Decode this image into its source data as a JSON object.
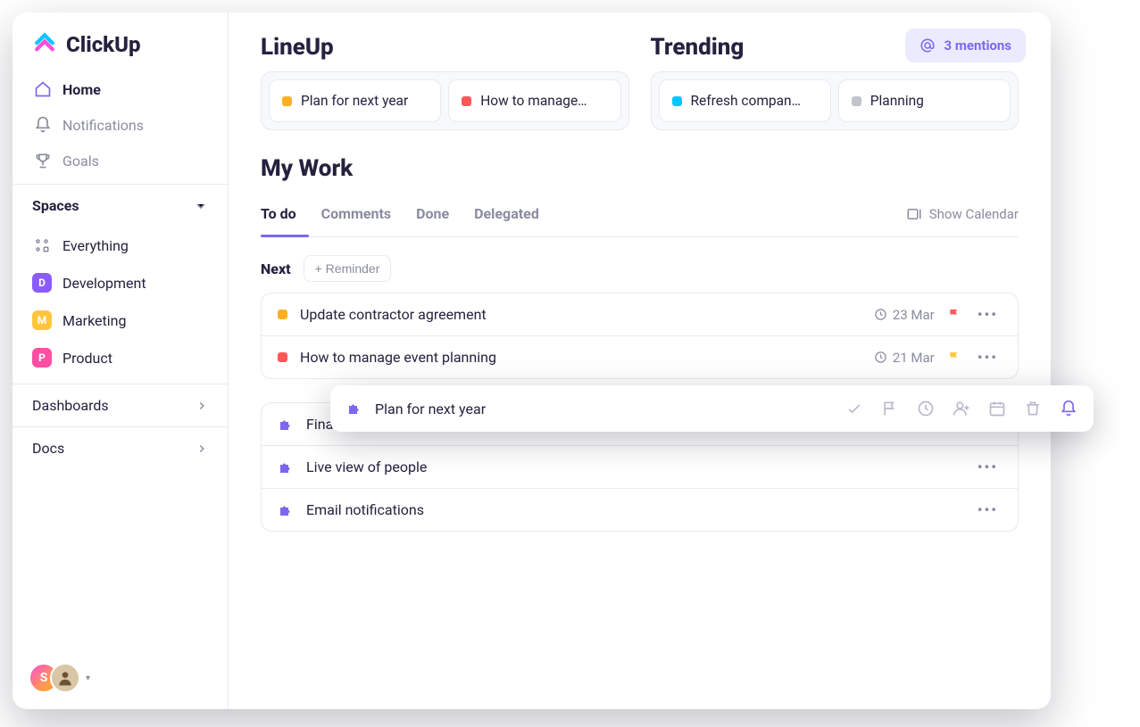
{
  "brand": {
    "name": "ClickUp"
  },
  "colors": {
    "accent": "#7b68ee",
    "orange": "#ffb020",
    "red": "#ff5757",
    "cyan": "#00c8ff",
    "grey": "#c1c3cc",
    "yellow": "#ffc63d",
    "purple": "#7b68ee",
    "pink": "#ff4fa3",
    "violet": "#8a5cff"
  },
  "nav": {
    "home": "Home",
    "notifications": "Notifications",
    "goals": "Goals"
  },
  "spaces": {
    "header": "Spaces",
    "everything": "Everything",
    "items": [
      {
        "letter": "D",
        "label": "Development",
        "color": "#8a5cff"
      },
      {
        "letter": "M",
        "label": "Marketing",
        "color": "#ffc63d"
      },
      {
        "letter": "P",
        "label": "Product",
        "color": "#ff4fa3"
      }
    ]
  },
  "footer": {
    "dashboards": "Dashboards",
    "docs": "Docs"
  },
  "avatars": {
    "initial": "S"
  },
  "mentions": {
    "label": "3 mentions"
  },
  "lineup": {
    "title": "LineUp",
    "cards": [
      {
        "text": "Plan for next year",
        "dot": "#ffb020"
      },
      {
        "text": "How to manage…",
        "dot": "#ff5757"
      }
    ]
  },
  "trending": {
    "title": "Trending",
    "cards": [
      {
        "text": "Refresh compan…",
        "dot": "#00c8ff"
      },
      {
        "text": "Planning",
        "dot": "#c1c3cc"
      }
    ]
  },
  "mywork": {
    "title": "My Work",
    "tabs": {
      "todo": "To do",
      "comments": "Comments",
      "done": "Done",
      "delegated": "Delegated"
    },
    "show_calendar": "Show Calendar",
    "next": "Next",
    "reminder": "+ Reminder",
    "tasks_upper": [
      {
        "name": "Update contractor agreement",
        "dot": "#ffb020",
        "date": "23 Mar",
        "flag": "#ff5757"
      },
      {
        "name": "How to manage event planning",
        "dot": "#ff5757",
        "date": "21 Mar",
        "flag": "#ffc63d"
      }
    ],
    "tasks_lower": [
      {
        "name": "Finalize project scope"
      },
      {
        "name": "Live view of people"
      },
      {
        "name": "Email notifications"
      }
    ]
  },
  "popover": {
    "title": "Plan for next year"
  }
}
